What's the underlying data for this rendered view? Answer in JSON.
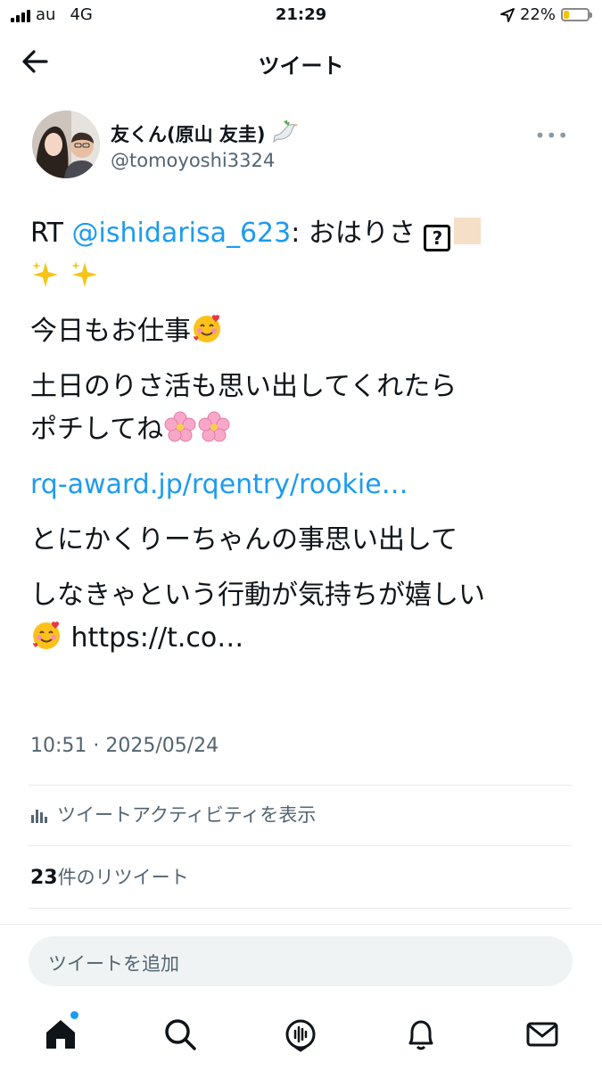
{
  "status_bar": {
    "carrier": "au",
    "network": "4G",
    "time": "21:29",
    "battery": "22%",
    "battery_level": 0.22
  },
  "nav": {
    "title": "ツイート",
    "back_icon": "arrow-left-icon"
  },
  "author": {
    "display_name": "友くん(原山 友圭)",
    "handle": "@tomoyoshi3324",
    "badge_icon": "dove-icon",
    "more_label": "•••"
  },
  "tweet": {
    "rt_prefix": "RT ",
    "rt_mention": "@ishidarisa_623",
    "rt_text": ": おはりさ",
    "line_work": "今日もお仕事",
    "line_weekend": "土日のりさ活も思い出してくれたら",
    "line_pochi": "ポチしてね",
    "link": "rq-award.jp/rqentry/rookie…",
    "line_remember": "とにかくりーちゃんの事思い出して",
    "line_action": "しなきゃという行動が気持ちが嬉しい",
    "tail_link": " https://t.co…"
  },
  "meta": {
    "timestamp": "10:51 · 2025/05/24",
    "analytics_label": "ツイートアクティビティを表示",
    "retweet_count": "23",
    "retweet_label": "件のリツイート"
  },
  "reply": {
    "placeholder": "ツイートを追加"
  },
  "tabs": [
    "home-icon",
    "search-icon",
    "spaces-icon",
    "notifications-icon",
    "messages-icon"
  ],
  "colors": {
    "link": "#1d9bf0",
    "secondary_text": "#536471",
    "notification_dot": "#1d9bf0"
  }
}
